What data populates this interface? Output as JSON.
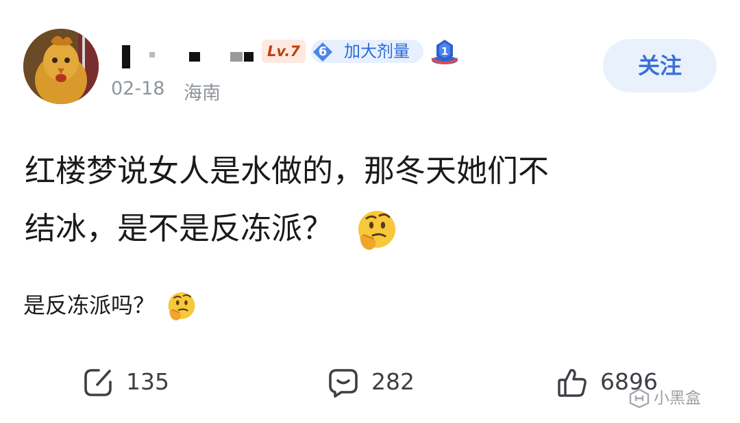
{
  "header": {
    "avatar_icon": "rooster-avatar",
    "level_badge": "Lv.7",
    "tag_badge": {
      "number": "6",
      "label": "加大剂量",
      "color": "#2f6bd6"
    },
    "rank_icon": "rank-1-medal-icon",
    "date": "02-18",
    "location": "海南",
    "follow_label": "关注"
  },
  "post": {
    "title_line1": "红楼梦说女人是水做的，那冬天她们不",
    "title_line2": "结冰，是不是反冻派？",
    "title_emoji": "thinking-face-emoji",
    "body": "是反冻派吗？",
    "body_emoji": "thinking-face-emoji"
  },
  "actions": {
    "share_count": "135",
    "comment_count": "282",
    "like_count": "6896"
  },
  "watermark": {
    "text": "小黑盒"
  },
  "colors": {
    "accent": "#3a6fd8",
    "follow_bg": "#e9f1fd",
    "meta_text": "#8f949b",
    "level_text": "#c2410c",
    "level_bg": "#fde9e0"
  }
}
